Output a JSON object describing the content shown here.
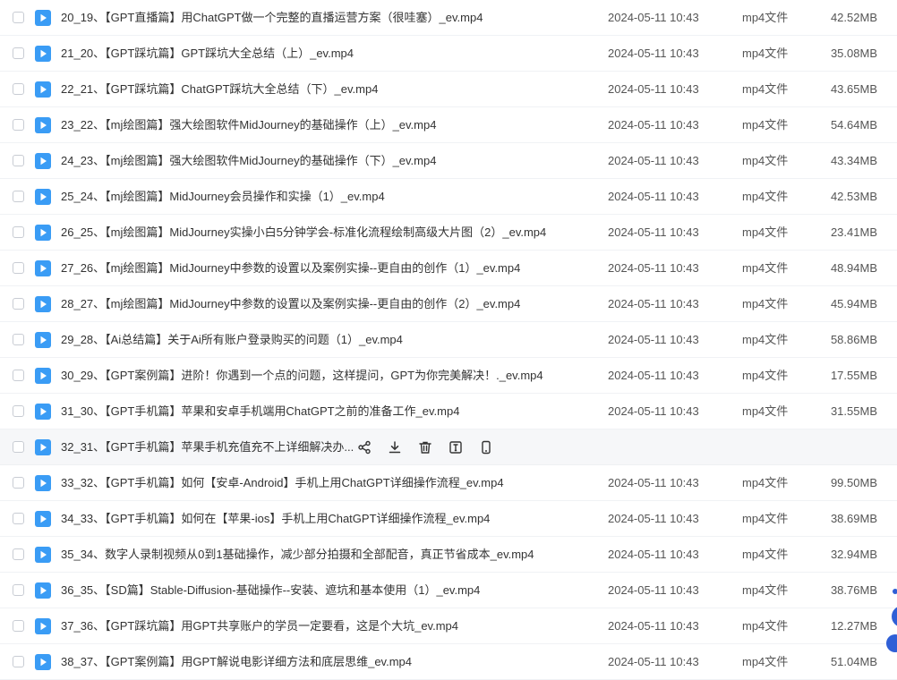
{
  "table": {
    "type_label": "mp4文件",
    "rows": [
      {
        "name": "20_19、【GPT直播篇】用ChatGPT做一个完整的直播运营方案（很哇塞）_ev.mp4",
        "date": "2024-05-11 10:43",
        "size": "42.52MB"
      },
      {
        "name": "21_20、【GPT踩坑篇】GPT踩坑大全总结（上）_ev.mp4",
        "date": "2024-05-11 10:43",
        "size": "35.08MB"
      },
      {
        "name": "22_21、【GPT踩坑篇】ChatGPT踩坑大全总结（下）_ev.mp4",
        "date": "2024-05-11 10:43",
        "size": "43.65MB"
      },
      {
        "name": "23_22、【mj绘图篇】强大绘图软件MidJourney的基础操作（上）_ev.mp4",
        "date": "2024-05-11 10:43",
        "size": "54.64MB"
      },
      {
        "name": "24_23、【mj绘图篇】强大绘图软件MidJourney的基础操作（下）_ev.mp4",
        "date": "2024-05-11 10:43",
        "size": "43.34MB"
      },
      {
        "name": "25_24、【mj绘图篇】MidJourney会员操作和实操（1）_ev.mp4",
        "date": "2024-05-11 10:43",
        "size": "42.53MB"
      },
      {
        "name": "26_25、【mj绘图篇】MidJourney实操小白5分钟学会-标准化流程绘制高级大片图（2）_ev.mp4",
        "date": "2024-05-11 10:43",
        "size": "23.41MB"
      },
      {
        "name": "27_26、【mj绘图篇】MidJourney中参数的设置以及案例实操--更自由的创作（1）_ev.mp4",
        "date": "2024-05-11 10:43",
        "size": "48.94MB"
      },
      {
        "name": "28_27、【mj绘图篇】MidJourney中参数的设置以及案例实操--更自由的创作（2）_ev.mp4",
        "date": "2024-05-11 10:43",
        "size": "45.94MB"
      },
      {
        "name": "29_28、【Ai总结篇】关于Ai所有账户登录购买的问题（1）_ev.mp4",
        "date": "2024-05-11 10:43",
        "size": "58.86MB"
      },
      {
        "name": "30_29、【GPT案例篇】进阶！你遇到一个点的问题，这样提问，GPT为你完美解决！._ev.mp4",
        "date": "2024-05-11 10:43",
        "size": "17.55MB"
      },
      {
        "name": "31_30、【GPT手机篇】苹果和安卓手机端用ChatGPT之前的准备工作_ev.mp4",
        "date": "2024-05-11 10:43",
        "size": "31.55MB"
      },
      {
        "name": "32_31、【GPT手机篇】苹果手机充值充不上详细解决办...",
        "date": "",
        "size": "",
        "hover": true
      },
      {
        "name": "33_32、【GPT手机篇】如何【安卓-Android】手机上用ChatGPT详细操作流程_ev.mp4",
        "date": "2024-05-11 10:43",
        "size": "99.50MB"
      },
      {
        "name": "34_33、【GPT手机篇】如何在【苹果-ios】手机上用ChatGPT详细操作流程_ev.mp4",
        "date": "2024-05-11 10:43",
        "size": "38.69MB"
      },
      {
        "name": "35_34、数字人录制视频从0到1基础操作，减少部分拍摄和全部配音，真正节省成本_ev.mp4",
        "date": "2024-05-11 10:43",
        "size": "32.94MB"
      },
      {
        "name": "36_35、【SD篇】Stable-Diffusion-基础操作--安装、遮坑和基本使用（1）_ev.mp4",
        "date": "2024-05-11 10:43",
        "size": "38.76MB"
      },
      {
        "name": "37_36、【GPT踩坑篇】用GPT共享账户的学员一定要看，这是个大坑_ev.mp4",
        "date": "2024-05-11 10:43",
        "size": "12.27MB"
      },
      {
        "name": "38_37、【GPT案例篇】用GPT解说电影详细方法和底层思维_ev.mp4",
        "date": "2024-05-11 10:43",
        "size": "51.04MB"
      }
    ]
  },
  "hover_actions": [
    {
      "icon": "share-icon"
    },
    {
      "icon": "download-icon"
    },
    {
      "icon": "delete-icon"
    },
    {
      "icon": "rename-icon"
    },
    {
      "icon": "phone-icon"
    }
  ],
  "colors": {
    "file_icon": "#3a9cf5",
    "accent": "#2f5fd6",
    "hover_row": "#f6f7f9"
  }
}
